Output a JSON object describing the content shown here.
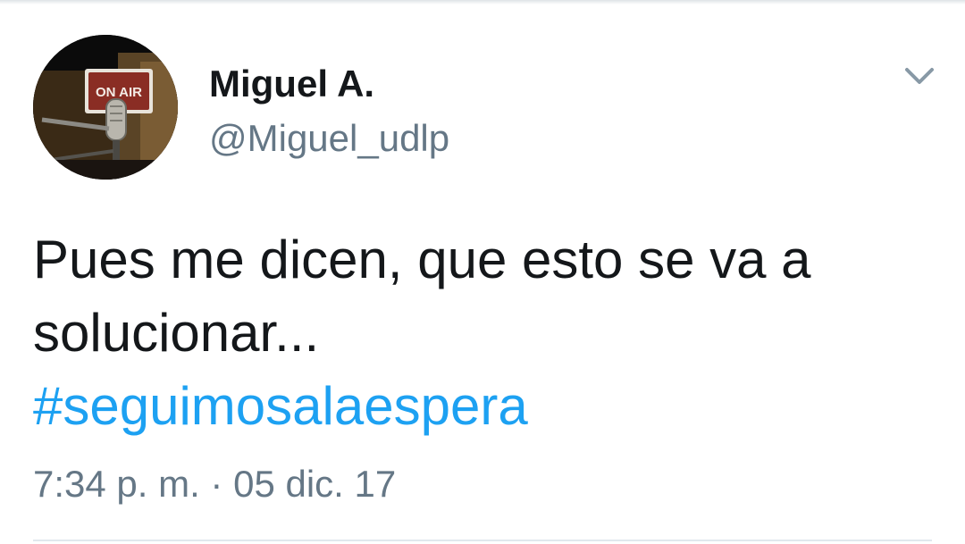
{
  "tweet": {
    "author": {
      "display_name": "Miguel A.",
      "handle": "@Miguel_udlp",
      "avatar_sign_text": "ON AIR"
    },
    "text_lines": [
      "Pues me dicen, que esto se va a",
      "solucionar..."
    ],
    "hashtag": "#seguimosalaespera",
    "timestamp": "7:34 p. m. · 05 dic. 17"
  },
  "colors": {
    "text": "#14171a",
    "secondary": "#657786",
    "link": "#1da1f2",
    "divider": "#e1e8ed"
  },
  "icons": {
    "caret": "chevron-down-icon",
    "avatar": "on-air-microphone-photo"
  }
}
